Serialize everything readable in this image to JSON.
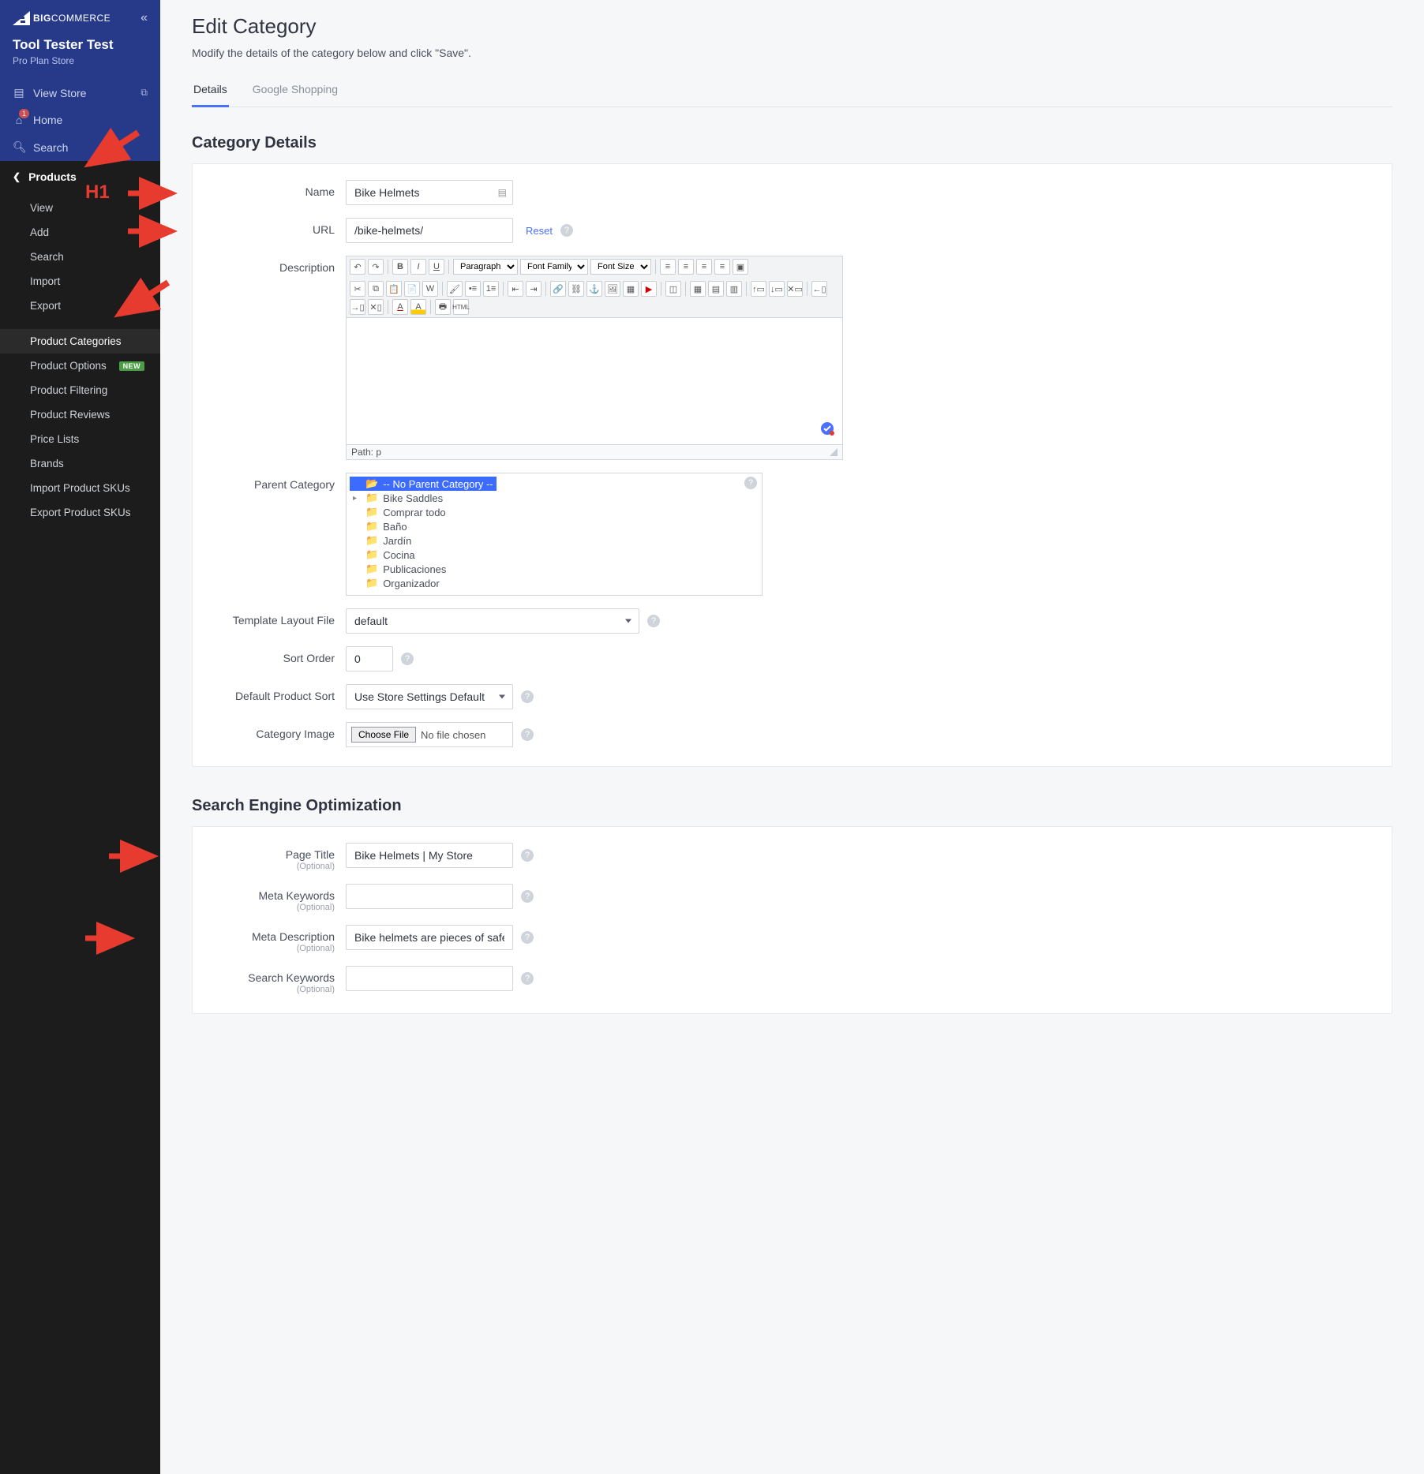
{
  "brand": {
    "big": "BIG",
    "commerce": "COMMERCE"
  },
  "store": {
    "name": "Tool Tester Test",
    "plan": "Pro Plan Store"
  },
  "nav": {
    "view_store": "View Store",
    "home": "Home",
    "search": "Search"
  },
  "section": {
    "products": "Products"
  },
  "products_menu": {
    "view": "View",
    "add": "Add",
    "search": "Search",
    "import": "Import",
    "export": "Export",
    "product_categories": "Product Categories",
    "product_options": "Product Options",
    "new": "NEW",
    "product_filtering": "Product Filtering",
    "product_reviews": "Product Reviews",
    "price_lists": "Price Lists",
    "brands": "Brands",
    "import_skus": "Import Product SKUs",
    "export_skus": "Export Product SKUs"
  },
  "page": {
    "title": "Edit Category",
    "subtitle": "Modify the details of the category below and click \"Save\"."
  },
  "tabs": {
    "details": "Details",
    "google": "Google Shopping"
  },
  "category_details": {
    "heading": "Category Details",
    "labels": {
      "name": "Name",
      "url": "URL",
      "description": "Description",
      "parent": "Parent Category",
      "template": "Template Layout File",
      "sort": "Sort Order",
      "default_sort": "Default Product Sort",
      "image": "Category Image"
    },
    "values": {
      "name": "Bike Helmets",
      "url": "/bike-helmets/",
      "sort": "0",
      "template": "default",
      "default_sort": "Use Store Settings Default",
      "file": "No file chosen",
      "choose": "Choose File",
      "reset": "Reset"
    },
    "editor": {
      "paragraph": "Paragraph",
      "font_family": "Font Family",
      "font_size": "Font Size",
      "path": "Path: p"
    },
    "parent_tree": {
      "none": "-- No Parent Category --",
      "items": [
        "Bike Saddles",
        "Comprar todo",
        "Baño",
        "Jardín",
        "Cocina",
        "Publicaciones",
        "Organizador"
      ]
    }
  },
  "seo": {
    "heading": "Search Engine Optimization",
    "labels": {
      "page_title": "Page Title",
      "meta_keywords": "Meta Keywords",
      "meta_description": "Meta Description",
      "search_keywords": "Search Keywords",
      "optional": "(Optional)"
    },
    "values": {
      "page_title": "Bike Helmets | My Store",
      "meta_description": "Bike helmets are pieces of safety equipm"
    }
  },
  "annotations": {
    "h1": "H1"
  }
}
